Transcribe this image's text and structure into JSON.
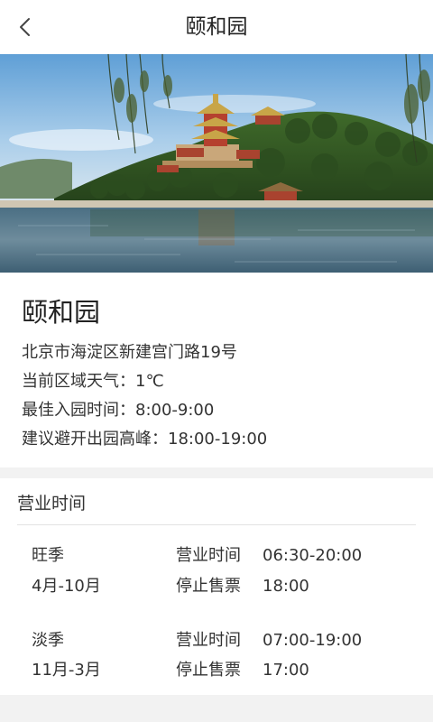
{
  "header": {
    "title": "颐和园"
  },
  "place": {
    "name": "颐和园",
    "address": "北京市海淀区新建宫门路19号",
    "weather": "当前区域天气：1℃",
    "best_time": "最佳入园时间：8:00-9:00",
    "avoid_peak": "建议避开出园高峰：18:00-19:00"
  },
  "hours": {
    "title": "营业时间",
    "seasons": [
      {
        "name": "旺季",
        "months": "4月-10月",
        "open_label": "营业时间",
        "open_value": "06:30-20:00",
        "stop_label": "停止售票",
        "stop_value": "18:00"
      },
      {
        "name": "淡季",
        "months": "11月-3月",
        "open_label": "营业时间",
        "open_value": "07:00-19:00",
        "stop_label": "停止售票",
        "stop_value": "17:00"
      }
    ]
  },
  "icons": {
    "back": "chevron-left-icon"
  },
  "colors": {
    "background": "#f2f2f2",
    "card": "#ffffff",
    "text": "#333333",
    "divider": "#e3e3e3"
  }
}
